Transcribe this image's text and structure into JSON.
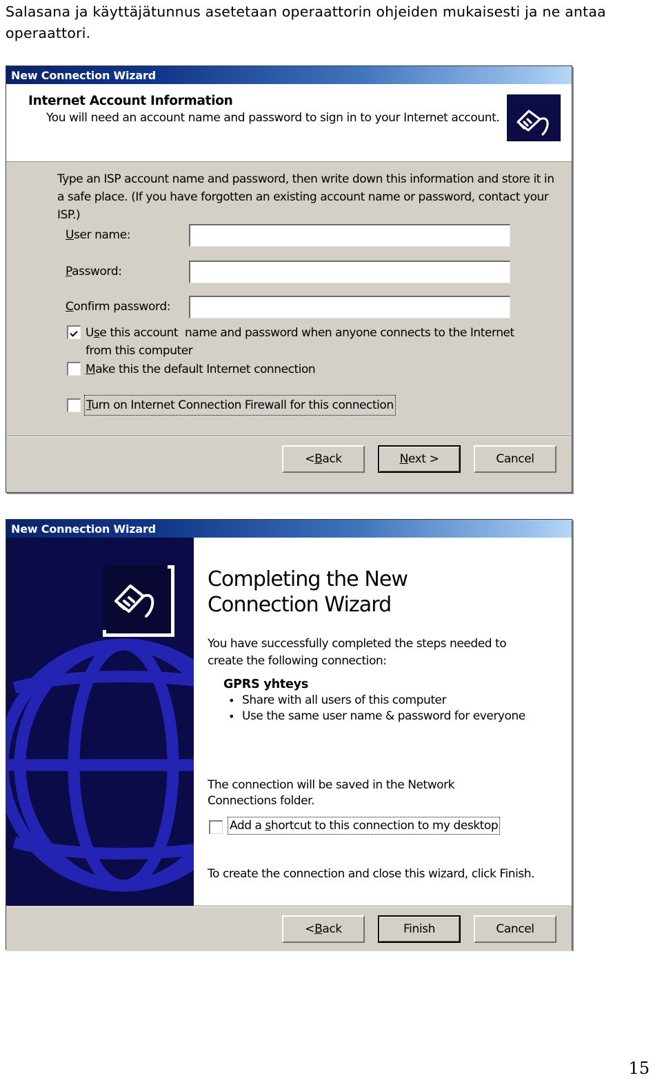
{
  "page": {
    "intro_text": "Salasana ja käyttäjätunnus asetetaan operaattorin ohjeiden mukaisesti ja ne antaa operaattori.",
    "page_number": "15",
    "colors": {
      "dialog_face": "#d4d0c8",
      "titlebar_start": "#0a246a",
      "titlebar_end": "#b6d6f5",
      "banner_background": "#0b0b4a",
      "banner_globe": "#1f1fae",
      "text": "#000000",
      "field_background": "#ffffff"
    }
  },
  "dialog1": {
    "title": "New Connection Wizard",
    "icon": "network-plug-icon",
    "header": {
      "heading": "Internet Account Information",
      "subheading": "You will need an account name and password to sign in to your Internet account."
    },
    "body_text": "Type an ISP account name and password, then write down this information and store it in a safe place. (If you have forgotten an existing account name or password, contact your ISP.)",
    "fields": [
      {
        "label": "User name:",
        "accel": "U",
        "value": "",
        "placeholder": ""
      },
      {
        "label": "Password:",
        "accel": "P",
        "value": "",
        "placeholder": ""
      },
      {
        "label": "Confirm password:",
        "accel": "C",
        "value": "",
        "placeholder": ""
      }
    ],
    "checkboxes": [
      {
        "label": "Use this account  name and password when anyone connects to the Internet from this computer",
        "accel": "s",
        "checked": true,
        "focused": false
      },
      {
        "label": "Make this the default Internet connection",
        "accel": "M",
        "checked": false,
        "focused": false
      },
      {
        "label": "Turn on Internet Connection Firewall for this connection",
        "accel": "T",
        "checked": false,
        "focused": true
      }
    ],
    "buttons": [
      {
        "label": "< Back",
        "accel": "B",
        "default": false
      },
      {
        "label": "Next >",
        "accel": "N",
        "default": true
      },
      {
        "label": "Cancel",
        "accel": "",
        "default": false
      }
    ]
  },
  "dialog2": {
    "title": "New Connection Wizard",
    "icon": "network-plug-icon",
    "banner_icon": "network-plug-icon",
    "heading": "Completing the New Connection Wizard",
    "lead_text": "You have successfully completed the steps needed to create the following connection:",
    "connection_name": "GPRS yhteys",
    "connection_properties": [
      "Share with all users of this computer",
      "Use the same user name & password for everyone"
    ],
    "saved_text": "The connection will be saved in the Network Connections folder.",
    "shortcut_checkbox": {
      "label": "Add a shortcut to this connection to my desktop",
      "accel": "s",
      "checked": false,
      "focused": true
    },
    "finish_note": "To create the connection and close this wizard, click Finish.",
    "buttons": [
      {
        "label": "< Back",
        "accel": "B",
        "default": false
      },
      {
        "label": "Finish",
        "accel": "",
        "default": true
      },
      {
        "label": "Cancel",
        "accel": "",
        "default": false
      }
    ]
  }
}
